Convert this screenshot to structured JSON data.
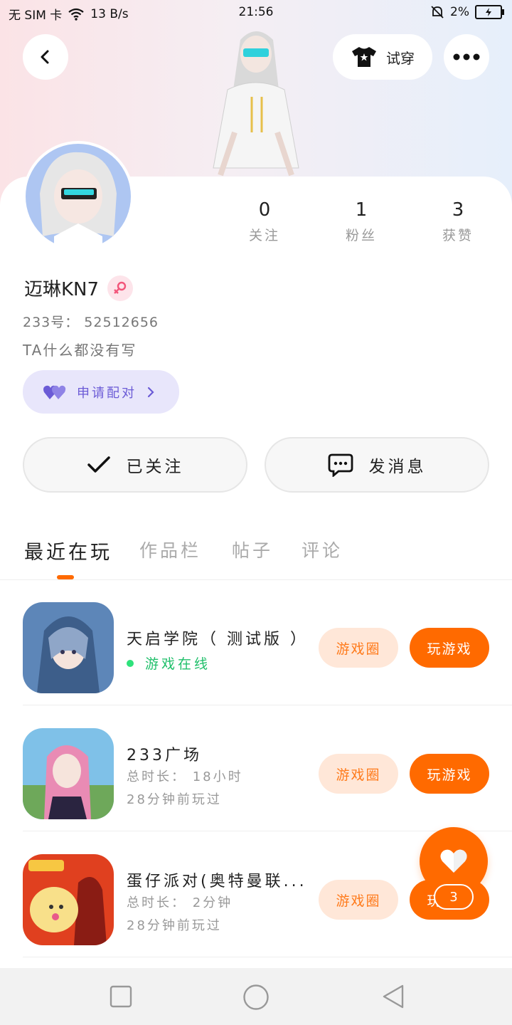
{
  "status_bar": {
    "sim": "无 SIM 卡",
    "speed": "13 B/s",
    "time": "21:56",
    "battery": "2%"
  },
  "header": {
    "try_on_label": "试穿",
    "icons": [
      "back-icon",
      "tshirt-icon",
      "more-icon"
    ]
  },
  "profile": {
    "name": "迈琳KN7",
    "gender_icon": "female-icon",
    "id_text": "233号： 52512656",
    "bio": "TA什么都没有写",
    "pair_label": "申请配对",
    "stats": [
      {
        "value": "0",
        "label": "关注"
      },
      {
        "value": "1",
        "label": "粉丝"
      },
      {
        "value": "3",
        "label": "获赞"
      }
    ]
  },
  "actions": {
    "followed_label": "已关注",
    "message_label": "发消息"
  },
  "tabs": [
    {
      "label": "最近在玩",
      "active": true
    },
    {
      "label": "作品栏",
      "active": false
    },
    {
      "label": "帖子",
      "active": false
    },
    {
      "label": "评论",
      "active": false
    }
  ],
  "games": [
    {
      "title": "天启学院（ 测试版 ）",
      "online": "游戏在线",
      "circle_label": "游戏圈",
      "play_label": "玩游戏"
    },
    {
      "title": "233广场",
      "duration": "总时长： 18小时",
      "last_played": "28分钟前玩过",
      "circle_label": "游戏圈",
      "play_label": "玩游戏"
    },
    {
      "title": "蛋仔派对(奥特曼联...",
      "duration": "总时长： 2分钟",
      "last_played": "28分钟前玩过",
      "circle_label": "游戏圈",
      "play_label": "玩游戏"
    }
  ],
  "fab": {
    "count": "3"
  },
  "colors": {
    "accent": "#ff6a00",
    "accent_light": "#ffe7d8",
    "pair_bg": "#e8e6fb",
    "online": "#1fbf6a"
  }
}
